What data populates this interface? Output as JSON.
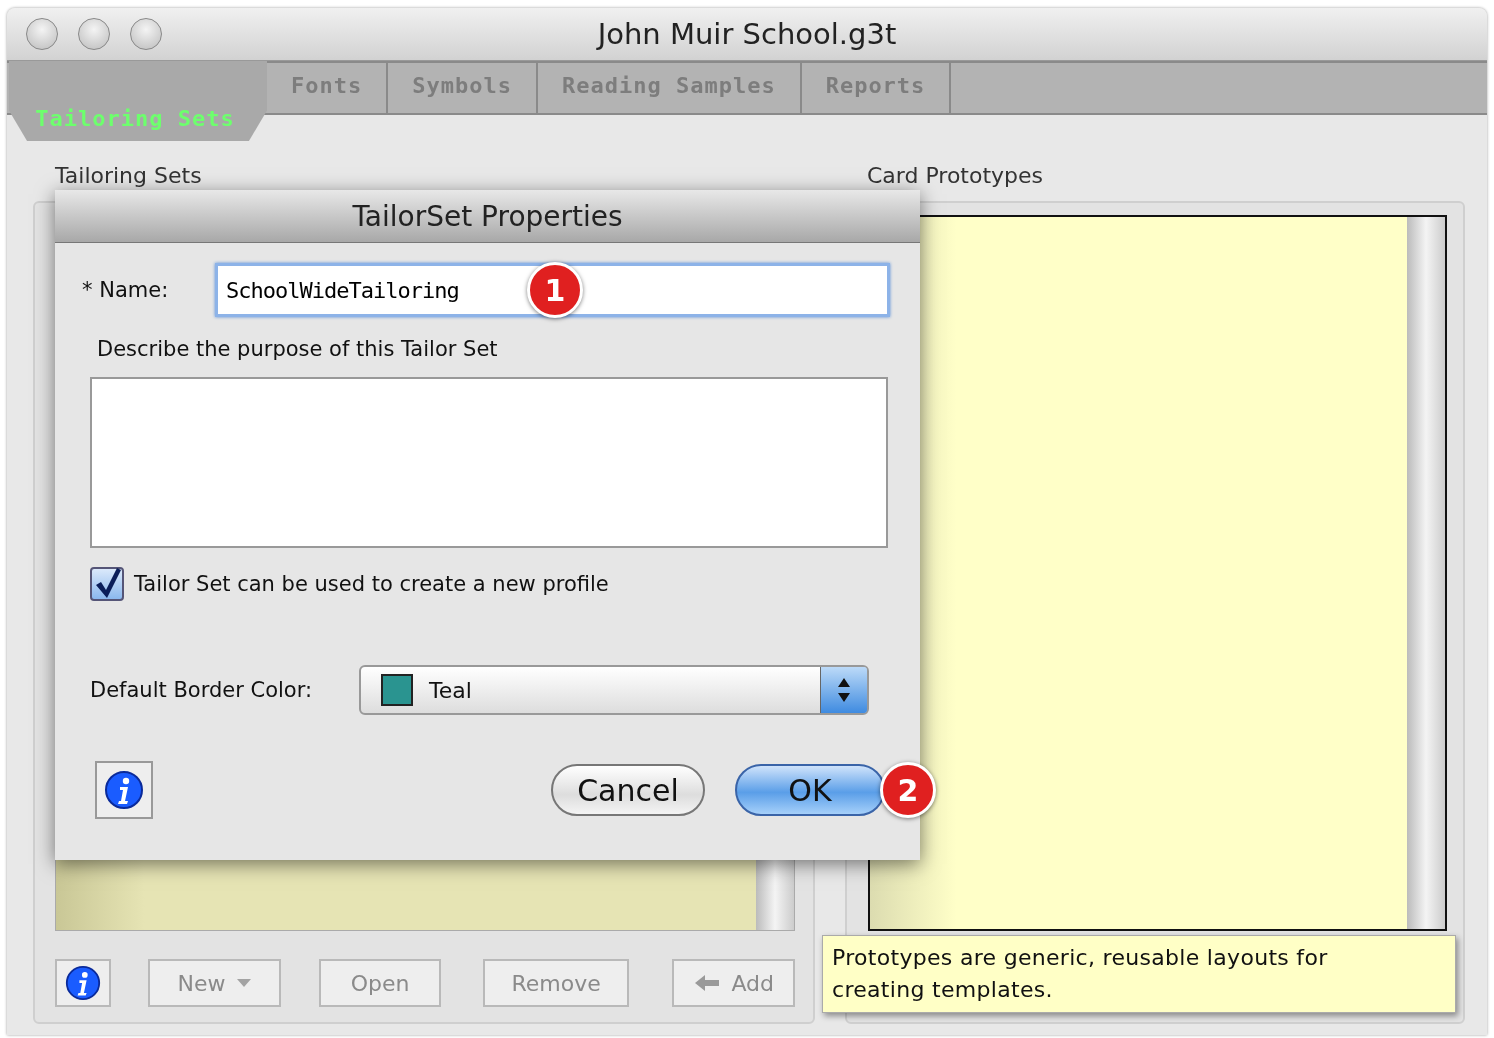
{
  "window": {
    "title": "John Muir School.g3t"
  },
  "tabs": [
    {
      "label": "Tailoring Sets",
      "selected": true
    },
    {
      "label": "Fonts",
      "selected": false
    },
    {
      "label": "Symbols",
      "selected": false
    },
    {
      "label": "Reading Samples",
      "selected": false
    },
    {
      "label": "Reports",
      "selected": false
    }
  ],
  "tailoring_sets": {
    "label": "Tailoring Sets",
    "buttons": [
      {
        "kind": "info",
        "disabled": false
      },
      {
        "kind": "menu",
        "label": "New",
        "disabled": true
      },
      {
        "kind": "plain",
        "label": "Open",
        "disabled": true
      },
      {
        "kind": "plain",
        "label": "Remove",
        "disabled": true
      },
      {
        "kind": "back",
        "label": "Add",
        "disabled": true
      }
    ]
  },
  "card_prototypes": {
    "label": "Card Prototypes"
  },
  "tooltip": {
    "text": "Prototypes are generic, reusable layouts for creating templates."
  },
  "dialog": {
    "title": "TailorSet Properties",
    "name_label": "* Name:",
    "name_value": "SchoolWideTailoring",
    "description_label": "Describe the purpose of this Tailor Set",
    "checkbox": {
      "label": "Tailor Set can be used to create a new profile",
      "checked": true
    },
    "border_color": {
      "label": "Default Border Color:",
      "value": "Teal",
      "color": "#2a9490"
    },
    "buttons": [
      {
        "label": "Cancel",
        "default": false
      },
      {
        "label": "OK",
        "default": true
      }
    ]
  },
  "callouts": [
    {
      "label": "1"
    },
    {
      "label": "2"
    }
  ]
}
